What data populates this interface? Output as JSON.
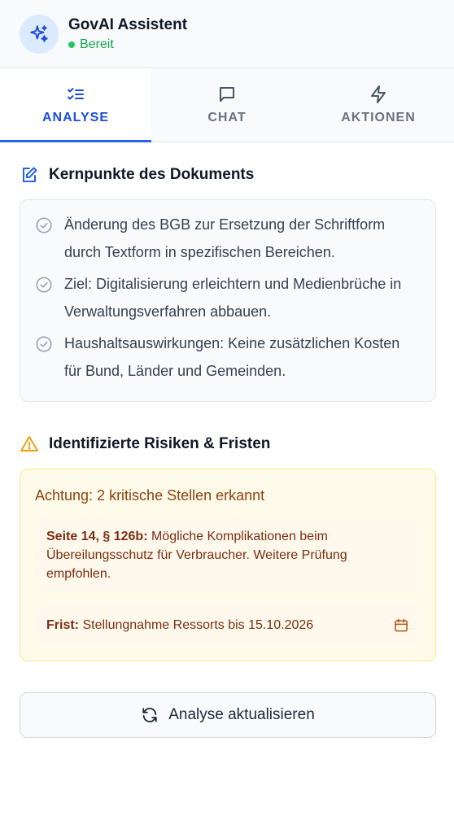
{
  "header": {
    "title": "GovAI Assistent",
    "status": "Bereit",
    "avatar_icon": "sparkles-icon",
    "status_color": "#22c55e"
  },
  "tabs": [
    {
      "label": "ANALYSE",
      "icon": "list-check-icon",
      "active": true
    },
    {
      "label": "CHAT",
      "icon": "chat-bubble-icon",
      "active": false
    },
    {
      "label": "AKTIONEN",
      "icon": "lightning-icon",
      "active": false
    }
  ],
  "key_points": {
    "title": "Kernpunkte des Dokuments",
    "icon": "document-edit-icon",
    "items": [
      "Änderung des BGB zur Ersetzung der Schriftform durch Textform in spezifischen Bereichen.",
      "Ziel: Digitalisierung erleichtern und Medienbrüche in Verwaltungsverfahren abbauen.",
      "Haushaltsauswirkungen: Keine zusätzlichen Kosten für Bund, Länder und Gemeinden."
    ]
  },
  "risks": {
    "title": "Identifizierte Risiken & Fristen",
    "icon": "warning-triangle-icon",
    "alert": "Achtung: 2 kritische Stellen erkannt",
    "items": [
      {
        "label": "Seite 14, § 126b:",
        "text": " Mögliche Komplikationen beim Übereilungsschutz für Verbraucher. Weitere Prüfung empfohlen."
      },
      {
        "label": "Frist:",
        "text": " Stellungnahme Ressorts bis 15.10.2026"
      }
    ],
    "accent": "#f59e0b"
  },
  "actions": {
    "refresh_label": "Analyse aktualisieren"
  }
}
